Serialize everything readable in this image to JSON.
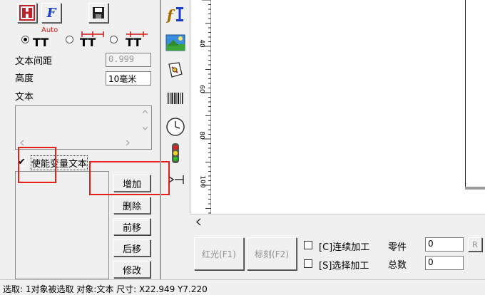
{
  "toolbar": {
    "icons": [
      "hatch-icon",
      "font-icon",
      "save-icon"
    ],
    "font_icon_glyph": "F"
  },
  "spacing_modes": {
    "auto_label": "Auto",
    "glyph": "TT",
    "selected_index": 0
  },
  "text_props": {
    "spacing_label": "文本间距",
    "spacing_value": "0.999",
    "height_label": "高度",
    "height_value": "10毫米",
    "text_label": "文本"
  },
  "variable_text": {
    "checkbox_label": "使能变量文本",
    "checked": true,
    "buttons": [
      "增加",
      "删除",
      "前移",
      "后移",
      "修改"
    ]
  },
  "tool_icons": [
    "text-tool-icon",
    "image-tool-icon",
    "vector-import-icon",
    "barcode-icon",
    "clock-icon",
    "traffic-light-icon",
    "extend-axis-icon"
  ],
  "ruler": {
    "labels": [
      "40",
      "60",
      "80",
      "100"
    ]
  },
  "bottom_panel": {
    "red_light_label": "红光(F1)",
    "mark_label": "标刻(F2)",
    "continuous_label": "[C]连续加工",
    "selected_label": "[S]选择加工",
    "parts_label": "零件",
    "parts_value": "0",
    "total_label": "总数",
    "total_value": "0",
    "reset_label": "R"
  },
  "status_bar": {
    "text": "选取: 1对象被选取 对象:文本 尺寸: X22.949 Y7.220"
  },
  "colors": {
    "highlight": "#e8201a",
    "background": "#f0f0f0"
  }
}
